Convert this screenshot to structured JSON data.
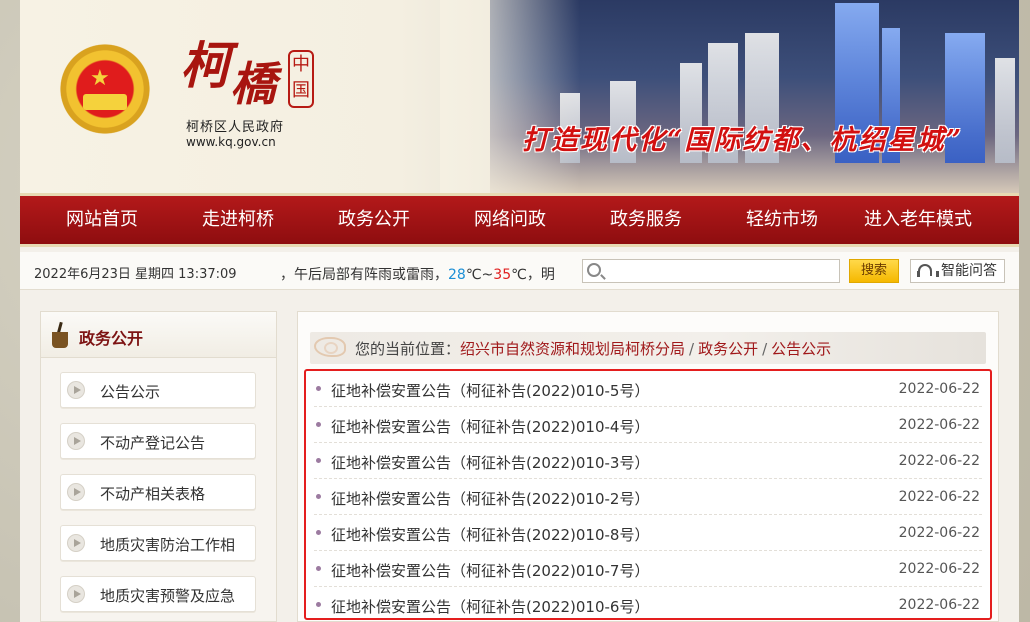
{
  "header": {
    "logo_chars": [
      "柯",
      "橋"
    ],
    "seal_chars": [
      "中",
      "国"
    ],
    "site_name": "柯桥区人民政府",
    "site_url": "www.kq.gov.cn",
    "slogan": "打造现代化“国际纺都、杭绍星城”"
  },
  "nav": {
    "items": [
      {
        "label": "网站首页"
      },
      {
        "label": "走进柯桥"
      },
      {
        "label": "政务公开"
      },
      {
        "label": "网络问政"
      },
      {
        "label": "政务服务"
      },
      {
        "label": "轻纺市场"
      },
      {
        "label": "进入老年模式"
      }
    ]
  },
  "infobar": {
    "datetime": "2022年6月23日 星期四 13:37:09",
    "weather_prefix": "，午后局部有阵雨或雷雨，",
    "temp_low": "28",
    "temp_sep": "℃~",
    "temp_high": "35",
    "weather_suffix": "℃，明",
    "search_placeholder": "",
    "search_button": "搜索",
    "qa_button": "智能问答"
  },
  "sidebar": {
    "title": "政务公开",
    "items": [
      {
        "label": "公告公示"
      },
      {
        "label": "不动产登记公告"
      },
      {
        "label": "不动产相关表格"
      },
      {
        "label": "地质灾害防治工作相"
      },
      {
        "label": "地质灾害预警及应急"
      }
    ]
  },
  "breadcrumb": {
    "prefix": "您的当前位置：",
    "links": [
      "绍兴市自然资源和规划局柯桥分局",
      "政务公开",
      "公告公示"
    ],
    "separator": "/"
  },
  "notices": [
    {
      "title": "征地补偿安置公告（柯征补告(2022)010-5号）",
      "date": "2022-06-22"
    },
    {
      "title": "征地补偿安置公告（柯征补告(2022)010-4号）",
      "date": "2022-06-22"
    },
    {
      "title": "征地补偿安置公告（柯征补告(2022)010-3号）",
      "date": "2022-06-22"
    },
    {
      "title": "征地补偿安置公告（柯征补告(2022)010-2号）",
      "date": "2022-06-22"
    },
    {
      "title": "征地补偿安置公告（柯征补告(2022)010-8号）",
      "date": "2022-06-22"
    },
    {
      "title": "征地补偿安置公告（柯征补告(2022)010-7号）",
      "date": "2022-06-22"
    },
    {
      "title": "征地补偿安置公告（柯征补告(2022)010-6号）",
      "date": "2022-06-22"
    }
  ],
  "colors": {
    "brand_red": "#a8150f",
    "nav_red": "#9e1213",
    "highlight_border": "#e41e1e",
    "temp_low": "#1c8fd6",
    "temp_high": "#e02020",
    "search_button": "#f5b800"
  },
  "icons": {
    "emblem": "national-emblem",
    "search": "search-icon",
    "qa": "headset-icon",
    "sidebar_head": "brush-pot-icon",
    "sidebar_item": "play-circle-icon",
    "breadcrumb": "cloud-scroll-icon"
  }
}
